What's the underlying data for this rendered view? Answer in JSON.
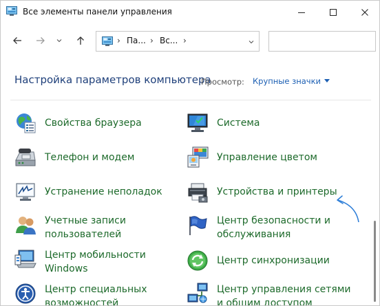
{
  "window": {
    "title": "Все элементы панели управления"
  },
  "navigation": {
    "back": "back",
    "forward": "forward",
    "recent": "recent",
    "up": "up",
    "address_segments": [
      "Па...",
      "Вс..."
    ],
    "search_placeholder": ""
  },
  "header": {
    "title": "Настройка параметров компьютера",
    "view_label": "Просмотр:",
    "view_value": "Крупные значки"
  },
  "items_left": [
    {
      "label": "Свойства браузера",
      "icon": "internet-options-icon"
    },
    {
      "label": "Телефон и модем",
      "icon": "phone-modem-icon"
    },
    {
      "label": "Устранение неполадок",
      "icon": "troubleshooting-icon"
    },
    {
      "label": "Учетные записи",
      "label2": "пользователей",
      "icon": "user-accounts-icon"
    },
    {
      "label": "Центр мобильности",
      "label2": "Windows",
      "icon": "mobility-center-icon"
    },
    {
      "label": "Центр специальных",
      "label2": "возможностей",
      "icon": "ease-of-access-icon"
    }
  ],
  "items_right": [
    {
      "label": "Система",
      "icon": "system-icon"
    },
    {
      "label": "Управление цветом",
      "icon": "color-management-icon"
    },
    {
      "label": "Устройства и принтеры",
      "icon": "devices-printers-icon"
    },
    {
      "label": "Центр безопасности и",
      "label2": "обслуживания",
      "icon": "security-maintenance-icon"
    },
    {
      "label": "Центр синхронизации",
      "icon": "sync-center-icon"
    },
    {
      "label": "Центр управления сетями",
      "label2": "и общим доступом",
      "icon": "network-sharing-icon"
    }
  ],
  "colors": {
    "link_green": "#1d6a2b",
    "title_blue": "#1e3f7a",
    "accent_blue": "#1c5fb3",
    "annotation_arrow": "#2f7fd8"
  }
}
